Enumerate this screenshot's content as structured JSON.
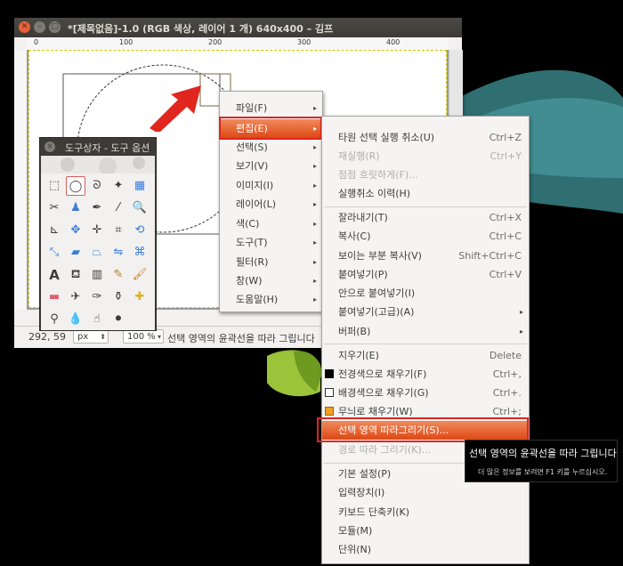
{
  "window": {
    "title": "*[제목없음]-1.0 (RGB 색상, 레이어 1 개) 640x400 – 김프",
    "ruler_labels": [
      "0",
      "100",
      "200",
      "300",
      "400"
    ]
  },
  "statusbar": {
    "coords": "292, 59",
    "unit": "px",
    "zoom": "100 %",
    "message": "선택 영역의 윤곽선을 따라 그립니다"
  },
  "toolbox": {
    "title": "도구상자 - 도구 옵션"
  },
  "menubar_menu": {
    "items": [
      {
        "label": "파일(F)"
      },
      {
        "label": "편집(E)"
      },
      {
        "label": "선택(S)"
      },
      {
        "label": "보기(V)"
      },
      {
        "label": "이미지(I)"
      },
      {
        "label": "레이어(L)"
      },
      {
        "label": "색(C)"
      },
      {
        "label": "도구(T)"
      },
      {
        "label": "필터(R)"
      },
      {
        "label": "창(W)"
      },
      {
        "label": "도움말(H)"
      }
    ]
  },
  "edit_menu": {
    "items": [
      {
        "label": "타원 선택 실행 취소(U)",
        "shortcut": "Ctrl+Z"
      },
      {
        "label": "재실행(R)",
        "shortcut": "Ctrl+Y"
      },
      {
        "label": "점점 흐릿하게(F)...",
        "shortcut": ""
      },
      {
        "label": "실행취소 이력(H)",
        "shortcut": ""
      },
      {
        "label": "잘라내기(T)",
        "shortcut": "Ctrl+X"
      },
      {
        "label": "복사(C)",
        "shortcut": "Ctrl+C"
      },
      {
        "label": "보이는 부분 복사(V)",
        "shortcut": "Shift+Ctrl+C"
      },
      {
        "label": "붙여넣기(P)",
        "shortcut": "Ctrl+V"
      },
      {
        "label": "안으로 붙여넣기(I)",
        "shortcut": ""
      },
      {
        "label": "붙여넣기(고급)(A)",
        "shortcut": ""
      },
      {
        "label": "버퍼(B)",
        "shortcut": ""
      },
      {
        "label": "지우기(E)",
        "shortcut": "Delete"
      },
      {
        "label": "전경색으로 채우기(F)",
        "shortcut": "Ctrl+,"
      },
      {
        "label": "배경색으로 채우기(G)",
        "shortcut": "Ctrl+."
      },
      {
        "label": "무늬로 채우기(W)",
        "shortcut": "Ctrl+;"
      },
      {
        "label": "선택 영역 따라그리기(S)...",
        "shortcut": ""
      },
      {
        "label": "경로 따라 그리기(K)...",
        "shortcut": ""
      },
      {
        "label": "기본 설정(P)",
        "shortcut": ""
      },
      {
        "label": "입력장치(I)",
        "shortcut": ""
      },
      {
        "label": "키보드 단축키(K)",
        "shortcut": ""
      },
      {
        "label": "모듈(M)",
        "shortcut": ""
      },
      {
        "label": "단위(N)",
        "shortcut": ""
      }
    ]
  },
  "tooltip": {
    "text": "선택 영역의 윤곽선을 따라 그립니다",
    "hint": "더 많은 정보를 보려면 F1 키를 누르십시오."
  },
  "colors": {
    "highlight": "#dd4814",
    "annotation_red": "#e0261e",
    "desktop": "#000000"
  }
}
